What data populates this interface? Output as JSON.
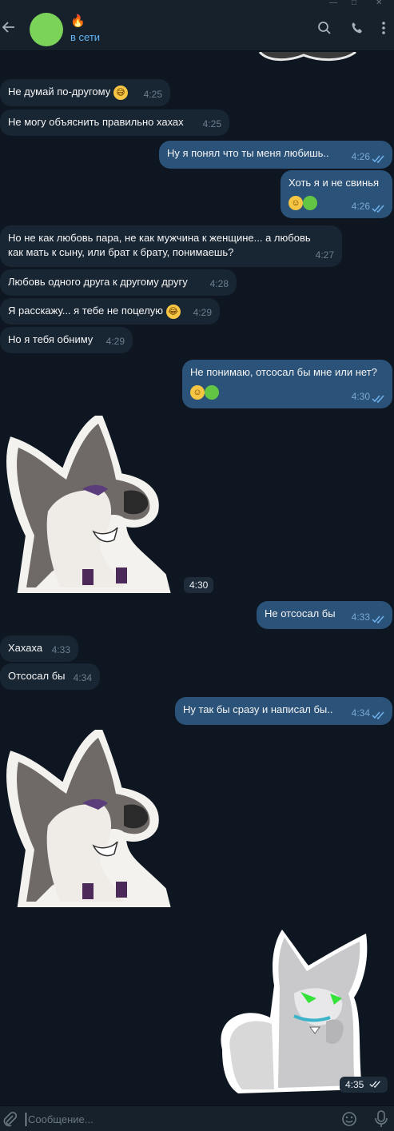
{
  "header": {
    "name": "🔥",
    "status": "в сети",
    "avatar_color": "#7bd35a",
    "icons": [
      "back-arrow-icon",
      "search-icon",
      "phone-icon",
      "more-icon"
    ]
  },
  "messages": [
    {
      "id": "m1",
      "dir": "in",
      "text": "Не думай по-другому",
      "emoji": "😅",
      "time": "4:25"
    },
    {
      "id": "m2",
      "dir": "in",
      "text": "Не могу объяснить правильно хахах",
      "time": "4:25"
    },
    {
      "id": "m3",
      "dir": "out",
      "text": "Ну я понял что ты меня любишь..",
      "time": "4:26"
    },
    {
      "id": "m4",
      "dir": "out",
      "text": "Хоть я и не свинья",
      "emoji_line": "🤣🟢",
      "time": "4:26"
    },
    {
      "id": "m5",
      "dir": "in",
      "text": "Но не как любовь пара, не как мужчина к женщине... а любовь как мать к сыну, или брат к брату, понимаешь?",
      "time": "4:27"
    },
    {
      "id": "m6",
      "dir": "in",
      "text": "Любовь одного друга к другому другу",
      "time": "4:28"
    },
    {
      "id": "m7",
      "dir": "in",
      "text": "Я расскажу... я тебе не поцелую",
      "emoji": "😂",
      "time": "4:29"
    },
    {
      "id": "m8",
      "dir": "in",
      "text": "Но я тебя обниму",
      "time": "4:29"
    },
    {
      "id": "m9",
      "dir": "out",
      "text": "Не понимаю, отсосал бы мне или нет?",
      "emoji_line": "🤣🟢",
      "time": "4:30"
    },
    {
      "id": "s1",
      "dir": "in",
      "type": "sticker",
      "time": "4:30"
    },
    {
      "id": "m10",
      "dir": "out",
      "text": "Не отсосал бы",
      "time": "4:33"
    },
    {
      "id": "m11",
      "dir": "in",
      "text": "Хахаха",
      "time": "4:33"
    },
    {
      "id": "m12",
      "dir": "in",
      "text": "Отсосал бы",
      "time": "4:34"
    },
    {
      "id": "m13",
      "dir": "out",
      "text": "Ну так бы сразу и написал бы..",
      "time": "4:34"
    },
    {
      "id": "s2",
      "dir": "in",
      "type": "sticker"
    },
    {
      "id": "s3",
      "dir": "out",
      "type": "sticker",
      "time": "4:35"
    }
  ],
  "input": {
    "placeholder": "Сообщение...",
    "icons": [
      "attach-icon",
      "emoji-icon",
      "microphone-icon"
    ]
  },
  "colors": {
    "background": "#0e1621",
    "incoming": "#182533",
    "outgoing": "#2b5278",
    "accent": "#5eb5f7"
  }
}
